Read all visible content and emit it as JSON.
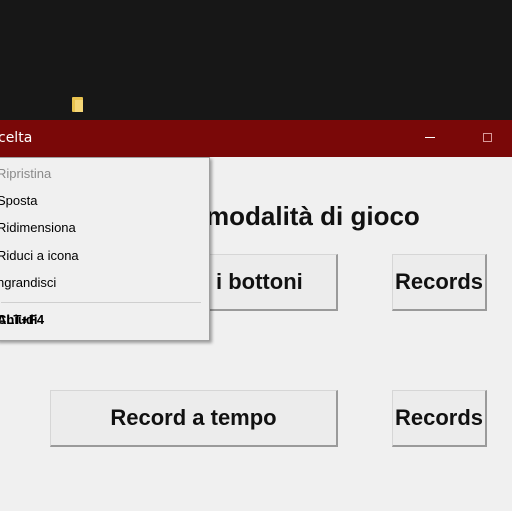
{
  "window": {
    "title": "celta"
  },
  "main": {
    "heading": "modalità di gioco",
    "buttons": {
      "bottoni": "i bottoni",
      "records_1": "Records",
      "tempo": "Record a tempo",
      "records_2": "Records"
    }
  },
  "system_menu": {
    "items": [
      {
        "label": "Ripristina",
        "enabled": false
      },
      {
        "label": "Sposta",
        "enabled": true
      },
      {
        "label": "Ridimensiona",
        "enabled": true
      },
      {
        "label": "Riduci a icona",
        "enabled": true
      },
      {
        "label": "ngrandisci",
        "enabled": true
      }
    ],
    "close": {
      "label": "Chiudi",
      "shortcut": "ALT+F4"
    }
  },
  "colors": {
    "titlebar": "#7a0808",
    "desktop": "#171717",
    "window_bg": "#f0f0f0"
  }
}
